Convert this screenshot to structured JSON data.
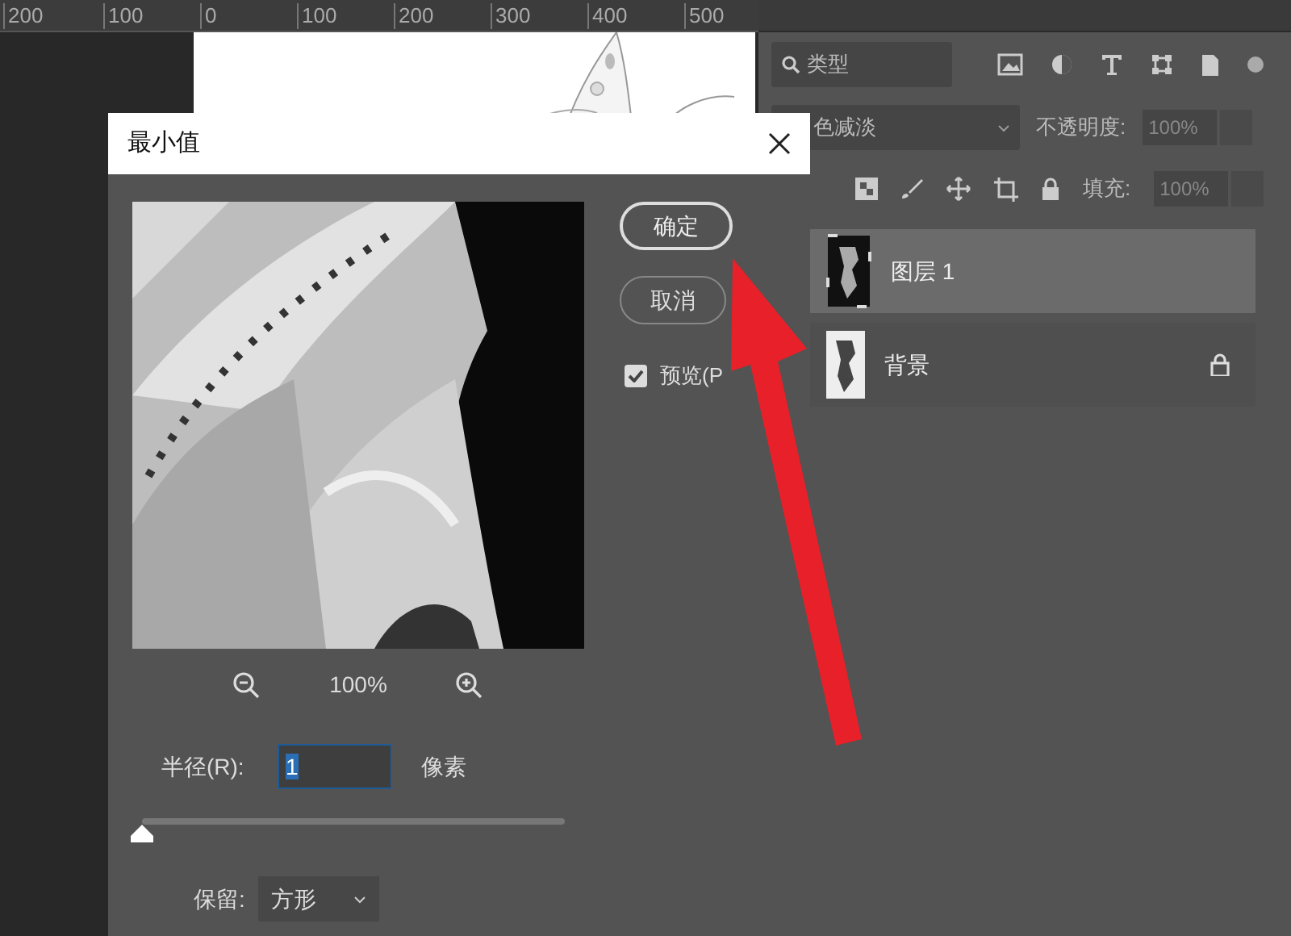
{
  "rulers": {
    "horizontal": [
      "200",
      "100",
      "0",
      "100",
      "200",
      "300",
      "400",
      "500"
    ]
  },
  "layers_panel": {
    "filter": {
      "value": "类型"
    },
    "blend_mode": "色减淡",
    "opacity": {
      "label": "不透明度:",
      "value": "100%",
      "disabled": true
    },
    "fill": {
      "label": "填充:",
      "value": "100%",
      "disabled": true
    },
    "layers": [
      {
        "name": "图层 1",
        "selected": true,
        "locked": false
      },
      {
        "name": "背景",
        "selected": false,
        "locked": true
      }
    ]
  },
  "dialog": {
    "title": "最小值",
    "buttons": [
      {
        "label": "确定",
        "selected": true
      },
      {
        "label": "取消",
        "selected": false
      }
    ],
    "preview_checkbox": {
      "label": "预览(P",
      "checked": true
    },
    "zoom": "100%",
    "radius": {
      "label": "半径(R):",
      "value": "1",
      "unit": "像素",
      "level": 0
    },
    "preserve": {
      "label": "保留:",
      "value": "方形"
    }
  }
}
